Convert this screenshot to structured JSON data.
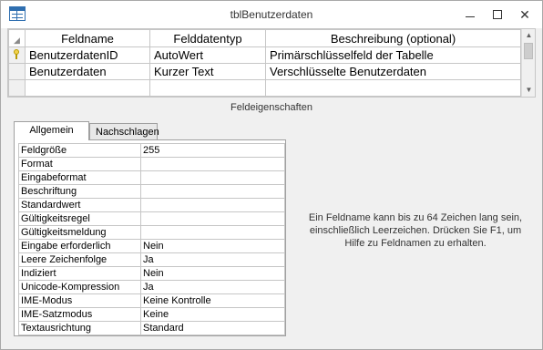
{
  "window": {
    "title": "tblBenutzerdaten"
  },
  "grid": {
    "headers": [
      "Feldname",
      "Felddatentyp",
      "Beschreibung (optional)"
    ],
    "rows": [
      {
        "name": "BenutzerdatenID",
        "type": "AutoWert",
        "description": "Primärschlüsselfeld der Tabelle",
        "primary_key": true
      },
      {
        "name": "Benutzerdaten",
        "type": "Kurzer Text",
        "description": "Verschlüsselte Benutzerdaten",
        "primary_key": false
      },
      {
        "name": "",
        "type": "",
        "description": "",
        "primary_key": false
      }
    ]
  },
  "properties": {
    "caption": "Feldeigenschaften",
    "tabs": [
      "Allgemein",
      "Nachschlagen"
    ],
    "active_tab": "Allgemein",
    "items": [
      {
        "label": "Feldgröße",
        "value": "255"
      },
      {
        "label": "Format",
        "value": ""
      },
      {
        "label": "Eingabeformat",
        "value": ""
      },
      {
        "label": "Beschriftung",
        "value": ""
      },
      {
        "label": "Standardwert",
        "value": ""
      },
      {
        "label": "Gültigkeitsregel",
        "value": ""
      },
      {
        "label": "Gültigkeitsmeldung",
        "value": ""
      },
      {
        "label": "Eingabe erforderlich",
        "value": "Nein"
      },
      {
        "label": "Leere Zeichenfolge",
        "value": "Ja"
      },
      {
        "label": "Indiziert",
        "value": "Nein"
      },
      {
        "label": "Unicode-Kompression",
        "value": "Ja"
      },
      {
        "label": "IME-Modus",
        "value": "Keine Kontrolle"
      },
      {
        "label": "IME-Satzmodus",
        "value": "Keine"
      },
      {
        "label": "Textausrichtung",
        "value": "Standard"
      }
    ]
  },
  "help": {
    "text": "Ein Feldname kann bis zu 64 Zeichen lang sein, einschließlich Leerzeichen. Drücken Sie F1, um Hilfe zu Feldnamen zu erhalten."
  },
  "icons": {
    "app": "table-icon",
    "key": "primary-key-icon",
    "minimize": "minimize-icon",
    "maximize": "maximize-icon",
    "close": "close-icon"
  }
}
